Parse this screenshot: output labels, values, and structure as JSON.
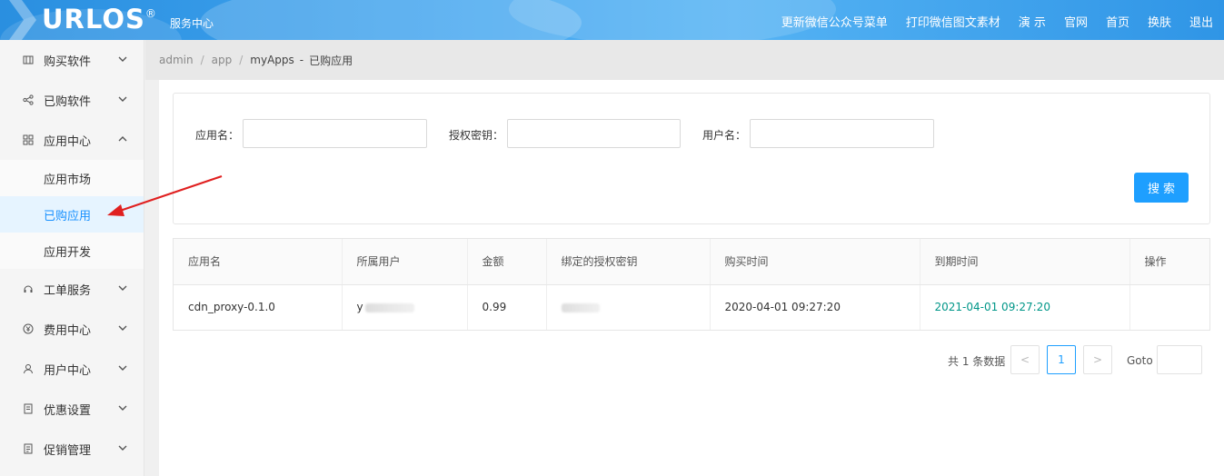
{
  "header": {
    "logo": "URLOS",
    "logo_reg": "®",
    "subtitle": "服务中心",
    "nav": [
      "更新微信公众号菜单",
      "打印微信图文素材",
      "演 示",
      "官网",
      "首页",
      "换肤",
      "退出"
    ]
  },
  "sidebar": {
    "items": [
      {
        "label": "购买软件",
        "icon": "shop-icon"
      },
      {
        "label": "已购软件",
        "icon": "share-icon"
      },
      {
        "label": "应用中心",
        "icon": "grid-icon",
        "expanded": true,
        "children": [
          "应用市场",
          "已购应用",
          "应用开发"
        ]
      },
      {
        "label": "工单服务",
        "icon": "headset-icon"
      },
      {
        "label": "费用中心",
        "icon": "yen-icon"
      },
      {
        "label": "用户中心",
        "icon": "user-icon"
      },
      {
        "label": "优惠设置",
        "icon": "ticket-icon"
      },
      {
        "label": "促销管理",
        "icon": "promo-icon"
      }
    ],
    "active_child": "已购应用"
  },
  "breadcrumb": {
    "items": [
      "admin",
      "app",
      "myApps"
    ],
    "separator": "/",
    "current": "已购应用"
  },
  "search": {
    "app_name_label": "应用名：",
    "auth_key_label": "授权密钥：",
    "username_label": "用户名：",
    "app_name_value": "",
    "auth_key_value": "",
    "username_value": "",
    "button": "搜索"
  },
  "table": {
    "columns": [
      "应用名",
      "所属用户",
      "金额",
      "绑定的授权密钥",
      "购买时间",
      "到期时间",
      "操作"
    ],
    "rows": [
      {
        "app": "cdn_proxy-0.1.0",
        "user": "y",
        "amount": "0.99",
        "key": "",
        "bought": "2020-04-01 09:27:20",
        "expires": "2021-04-01 09:27:20",
        "ops": ""
      }
    ]
  },
  "pagination": {
    "total_text": "共 1 条数据",
    "prev": "<",
    "next": ">",
    "current_page": "1",
    "goto_label": "Goto"
  },
  "colors": {
    "header_blue": "#2a8fe0",
    "accent": "#1e9fff",
    "expire_green": "#009688",
    "arrow_red": "#e02020"
  }
}
